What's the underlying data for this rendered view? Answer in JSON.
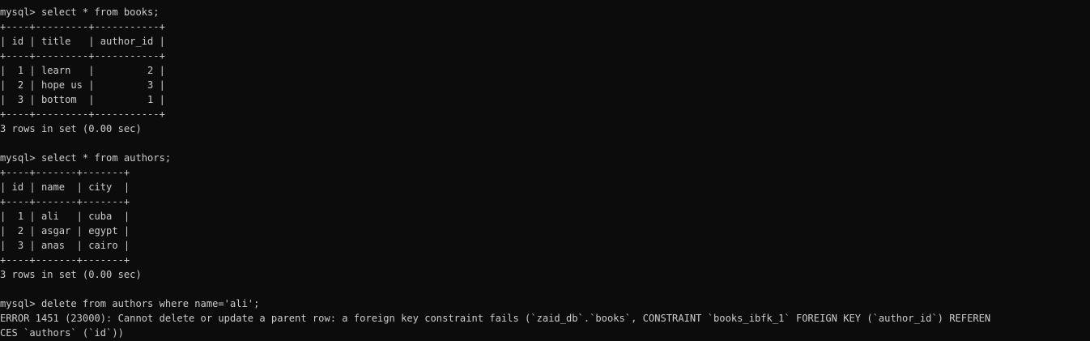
{
  "terminal": {
    "lines": [
      "mysql> select * from books;",
      "+----+---------+-----------+",
      "| id | title   | author_id |",
      "+----+---------+-----------+",
      "|  1 | learn   |         2 |",
      "|  2 | hope us |         3 |",
      "|  3 | bottom  |         1 |",
      "+----+---------+-----------+",
      "3 rows in set (0.00 sec)",
      "",
      "mysql> select * from authors;",
      "+----+-------+-------+",
      "| id | name  | city  |",
      "+----+-------+-------+",
      "|  1 | ali   | cuba  |",
      "|  2 | asgar | egypt |",
      "|  3 | anas  | cairo |",
      "+----+-------+-------+",
      "3 rows in set (0.00 sec)",
      "",
      "mysql> delete from authors where name='ali';",
      "ERROR 1451 (23000): Cannot delete or update a parent row: a foreign key constraint fails (`zaid_db`.`books`, CONSTRAINT `books_ibfk_1` FOREIGN KEY (`author_id`) REFEREN",
      "CES `authors` (`id`))"
    ],
    "colors": {
      "background": "#0c0c0c",
      "text": "#cccccc"
    }
  }
}
